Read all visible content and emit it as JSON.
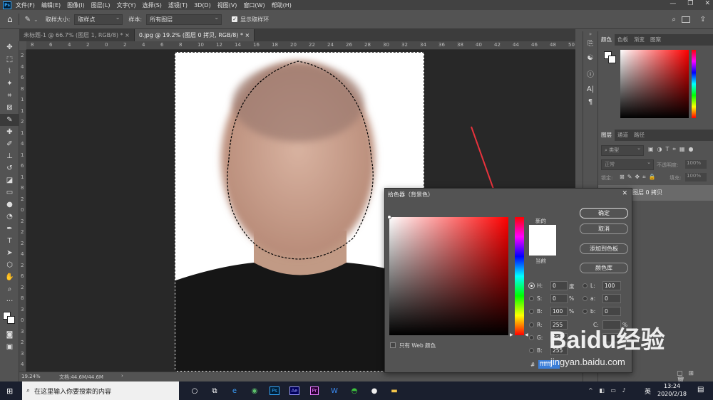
{
  "menu": {
    "app_icon": "Ps",
    "items": [
      "文件(F)",
      "编辑(E)",
      "图像(I)",
      "图层(L)",
      "文字(Y)",
      "选择(S)",
      "滤镜(T)",
      "3D(D)",
      "视图(V)",
      "窗口(W)",
      "帮助(H)"
    ],
    "window_controls": [
      "—",
      "❐",
      "✕"
    ]
  },
  "options": {
    "sample_size_label": "取样大小:",
    "sample_size_value": "取样点",
    "sample_label": "样本:",
    "sample_value": "所有图层",
    "show_ring_label": "显示取样环"
  },
  "tabs": [
    {
      "label": "未标题-1 @ 66.7% (图层 1, RGB/8) *",
      "close": "×"
    },
    {
      "label": "0.jpg @ 19.2% (图层 0 拷贝, RGB/8) *",
      "close": "×"
    }
  ],
  "ruler_top": [
    "8",
    "6",
    "4",
    "2",
    "0",
    "2",
    "4",
    "6",
    "8",
    "10",
    "12",
    "14",
    "16",
    "18",
    "20",
    "22",
    "24",
    "26",
    "28",
    "30",
    "32",
    "34",
    "36",
    "38",
    "40",
    "42",
    "44",
    "46",
    "48",
    "50"
  ],
  "ruler_left": [
    "2",
    "4",
    "6",
    "8",
    "1",
    "1",
    "2",
    "1",
    "4",
    "1",
    "6",
    "1",
    "8",
    "2",
    "0",
    "2",
    "2",
    "2",
    "4",
    "2",
    "6",
    "2",
    "8",
    "3",
    "0",
    "3",
    "2",
    "3",
    "4"
  ],
  "status": {
    "zoom": "19.24%",
    "doc": "文档:44.6M/44.6M",
    "arrow": "›"
  },
  "color_panel": {
    "tabs": [
      "颜色",
      "色板",
      "渐变",
      "图案"
    ]
  },
  "layers_panel": {
    "tabs": [
      "图层",
      "通道",
      "路径"
    ],
    "filter_label": "类型",
    "blend_mode": "正常",
    "opacity_label": "不透明度:",
    "opacity_value": "100%",
    "lock_label": "锁定:",
    "fill_label": "填充:",
    "fill_value": "100%",
    "layer_name": "图层 0 拷贝"
  },
  "dialog": {
    "title": "拾色器（背景色）",
    "close": "✕",
    "new_label": "新的",
    "current_label": "当前",
    "ok": "确定",
    "cancel": "取消",
    "add_swatch": "添加到色板",
    "color_library": "颜色库",
    "web_only": "只有 Web 颜色",
    "hsb": [
      {
        "l": "H:",
        "v": "0",
        "u": "度"
      },
      {
        "l": "S:",
        "v": "0",
        "u": "%"
      },
      {
        "l": "B:",
        "v": "100",
        "u": "%"
      }
    ],
    "rgb": [
      {
        "l": "R:",
        "v": "255"
      },
      {
        "l": "G:",
        "v": "255"
      },
      {
        "l": "B:",
        "v": "255"
      }
    ],
    "lab": [
      {
        "l": "L:",
        "v": "100"
      },
      {
        "l": "a:",
        "v": "0"
      },
      {
        "l": "b:",
        "v": "0"
      }
    ],
    "cmyk_c_label": "C:",
    "cmyk_c_unit": "%",
    "cmyk_m_unit": "%",
    "hex_label": "#",
    "hex_value": "ffffff"
  },
  "watermark": {
    "brand": "Baidu经验",
    "url": "jingyan.baidu.com"
  },
  "taskbar": {
    "search_placeholder": "在这里输入你要搜索的内容",
    "tray_lang": "英",
    "time": "13:24",
    "date": "2020/2/18"
  },
  "colors": {
    "accent_red": "#e8323c",
    "ps_blue": "#31a8ff"
  }
}
